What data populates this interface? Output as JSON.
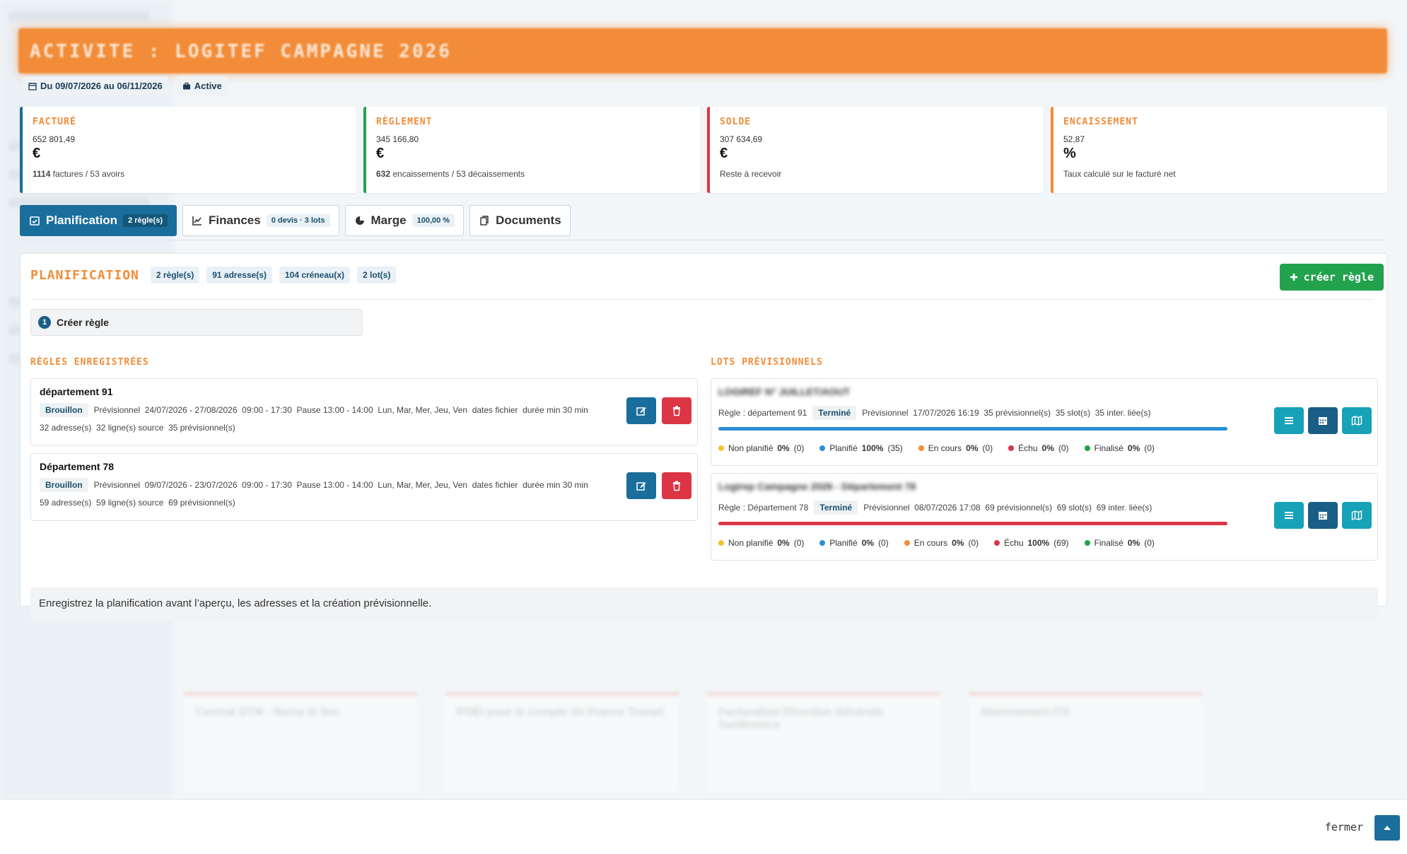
{
  "header": {
    "title": "ACTIVITE : LOGITEF CAMPAGNE 2026"
  },
  "meta": {
    "period": "Du 09/07/2026 au 06/11/2026",
    "status": "Active"
  },
  "stats": [
    {
      "label": "FACTURÉ",
      "value": "652 801,49",
      "unit": "€",
      "sub_bold": "1114",
      "sub": " factures / 53 avoirs",
      "color": "#1a6e9b"
    },
    {
      "label": "RÈGLEMENT",
      "value": "345 166,80",
      "unit": "€",
      "sub_bold": "632",
      "sub": " encaissements / 53 décaissements",
      "color": "#23a24d"
    },
    {
      "label": "SOLDE",
      "value": "307 634,69",
      "unit": "€",
      "sub_bold": "",
      "sub": "Reste à recevoir",
      "color": "#dc3545"
    },
    {
      "label": "ENCAISSEMENT",
      "value": "52,87",
      "unit": "%",
      "sub_bold": "",
      "sub": "Taux calculé sur le facturé net",
      "color": "#f28c38"
    }
  ],
  "tabs": [
    {
      "label": "Planification",
      "badge": "2 règle(s)"
    },
    {
      "label": "Finances",
      "badge": "0 devis · 3 lots"
    },
    {
      "label": "Marge",
      "badge": "100,00 %"
    },
    {
      "label": "Documents",
      "badge": ""
    }
  ],
  "planification": {
    "title": "PLANIFICATION",
    "pills": [
      "2 règle(s)",
      "91 adresse(s)",
      "104 créneau(x)",
      "2 lot(s)"
    ],
    "create_button": "créer règle",
    "step": {
      "num": "1",
      "label": "Créer règle"
    },
    "rules_title": "RÈGLES ENREGISTRÉES",
    "lots_title": "LOTS PRÉVISIONNELS",
    "rules": [
      {
        "name": "département 91",
        "status": "Brouillon",
        "details": "Prévisionnel  24/07/2026 - 27/08/2026  09:00 - 17:30  Pause 13:00 - 14:00  Lun, Mar, Mer, Jeu, Ven  dates fichier  durée min 30 min",
        "counts": "32 adresse(s)  32 ligne(s) source  35 prévisionnel(s)"
      },
      {
        "name": "Département 78",
        "status": "Brouillon",
        "details": "Prévisionnel  09/07/2026 - 23/07/2026  09:00 - 17:30  Pause 13:00 - 14:00  Lun, Mar, Mer, Jeu, Ven  dates fichier  durée min 30 min",
        "counts": "59 adresse(s)  59 ligne(s) source  69 prévisionnel(s)"
      }
    ],
    "lots": [
      {
        "name": "LOGIREF N° JUILLET/AOUT",
        "rule": "Règle : département 91",
        "status": "Terminé",
        "details": "Prévisionnel  17/07/2026 16:19  35 prévisionnel(s)  35 slot(s)  35 inter. liée(s)",
        "progress": 1.0,
        "bar_color": "#2b8fd6",
        "legend": [
          {
            "label": "Non planifié",
            "value": "0%",
            "count": "(0)",
            "color": "#f2c230"
          },
          {
            "label": "Planifié",
            "value": "100%",
            "count": "(35)",
            "color": "#2b8fd6"
          },
          {
            "label": "En cours",
            "value": "0%",
            "count": "(0)",
            "color": "#f28c38"
          },
          {
            "label": "Échu",
            "value": "0%",
            "count": "(0)",
            "color": "#dc3545"
          },
          {
            "label": "Finalisé",
            "value": "0%",
            "count": "(0)",
            "color": "#23a24d"
          }
        ]
      },
      {
        "name": "Logirep Campagne 2026 - Département 78",
        "rule": "Règle : Département 78",
        "status": "Terminé",
        "details": "Prévisionnel  08/07/2026 17:08  69 prévisionnel(s)  69 slot(s)  69 inter. liée(s)",
        "progress": 1.0,
        "bar_color": "#dc3545",
        "legend": [
          {
            "label": "Non planifié",
            "value": "0%",
            "count": "(0)",
            "color": "#f2c230"
          },
          {
            "label": "Planifié",
            "value": "0%",
            "count": "(0)",
            "color": "#2b8fd6"
          },
          {
            "label": "En cours",
            "value": "0%",
            "count": "(0)",
            "color": "#f28c38"
          },
          {
            "label": "Échu",
            "value": "100%",
            "count": "(69)",
            "color": "#dc3545"
          },
          {
            "label": "Finalisé",
            "value": "0%",
            "count": "(0)",
            "color": "#23a24d"
          }
        ]
      }
    ],
    "info": "Enregistrez la planification avant l’aperçu, les adresses et la création prévisionnelle."
  },
  "footer": {
    "close_label": "fermer"
  },
  "background": {
    "cards": [
      "Contrat GTM - Noisy le Sec",
      "POEI pour le compte de France Travail",
      "Facturation Direction Générale Sanitronics",
      "Abonnement ITS"
    ]
  }
}
